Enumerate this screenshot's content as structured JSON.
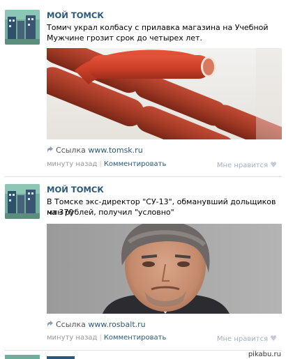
{
  "posts": [
    {
      "author": "МОЙ ТОМСК",
      "text_line1": "Томич украл колбасу с прилавка магазина на Учебной",
      "text_line2": "Мужчине грозит срок до четырех лет.",
      "link_prefix": "Ссылка",
      "link_domain": "www.tomsk.ru",
      "time": "минуту назад",
      "comment": "Комментировать",
      "like": "Мне нравится"
    },
    {
      "author": "МОЙ ТОМСК",
      "text_line1": "В Томске экс-директор \"СУ-13\", обманувший дольщиков на 370",
      "text_line2": "млн рублей, получил \"условно\"",
      "link_prefix": "Ссылка",
      "link_domain": "www.rosbalt.ru",
      "time": "минуту назад",
      "comment": "Комментировать",
      "like": "Мне нравится"
    }
  ],
  "watermark": "pikabu.ru",
  "colors": {
    "author": "#2b587a",
    "divider": "#dfe3e8",
    "meta": "#999999"
  },
  "icons": {
    "link": "share-arrow-icon",
    "like": "heart-icon"
  }
}
